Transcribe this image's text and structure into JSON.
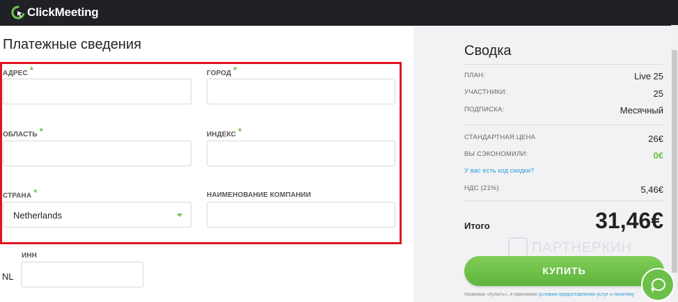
{
  "header": {
    "brand": "ClickMeeting",
    "colors": {
      "bar": "#1f2126",
      "accent": "#6cc04a"
    }
  },
  "billing": {
    "title": "Платежные сведения",
    "required_mark": "*",
    "fields": {
      "address": {
        "label": "АДРЕС",
        "value": ""
      },
      "city": {
        "label": "ГОРОД",
        "value": ""
      },
      "region": {
        "label": "ОБЛАСТЬ",
        "value": ""
      },
      "zip": {
        "label": "ИНДЕКС",
        "value": ""
      },
      "country": {
        "label": "СТРАНА",
        "value": "Netherlands"
      },
      "company": {
        "label": "НАИМЕНОВАНИЕ КОМПАНИИ",
        "value": ""
      },
      "tax_id": {
        "label": "ИНН",
        "prefix": "NL",
        "value": ""
      }
    },
    "highlight_color": "#e0141e"
  },
  "summary": {
    "title": "Сводка",
    "rows": [
      {
        "label": "ПЛАН:",
        "value": "Live 25"
      },
      {
        "label": "УЧАСТНИКИ:",
        "value": "25"
      },
      {
        "label": "ПОДПИСКА:",
        "value": "Месячный"
      },
      {
        "label": "СТАНДАРТНАЯ ЦЕНА",
        "value": "26€"
      },
      {
        "label": "ВЫ СЭКОНОМИЛИ:",
        "value": "0€"
      },
      {
        "label": "НДС (21%)",
        "value": "5,46€"
      }
    ],
    "discount_link": "У вас есть код скидки?",
    "total_label": "Итого",
    "total_value": "31,46€",
    "buy_button": "КУПИТЬ",
    "fineprint_text": "Нажимая «Купить», я принимаю",
    "fineprint_link": "условия предоставления услуг и политику"
  },
  "watermark": "ПАРТНЕРКИН",
  "chat": {
    "icon": "chat-icon"
  }
}
